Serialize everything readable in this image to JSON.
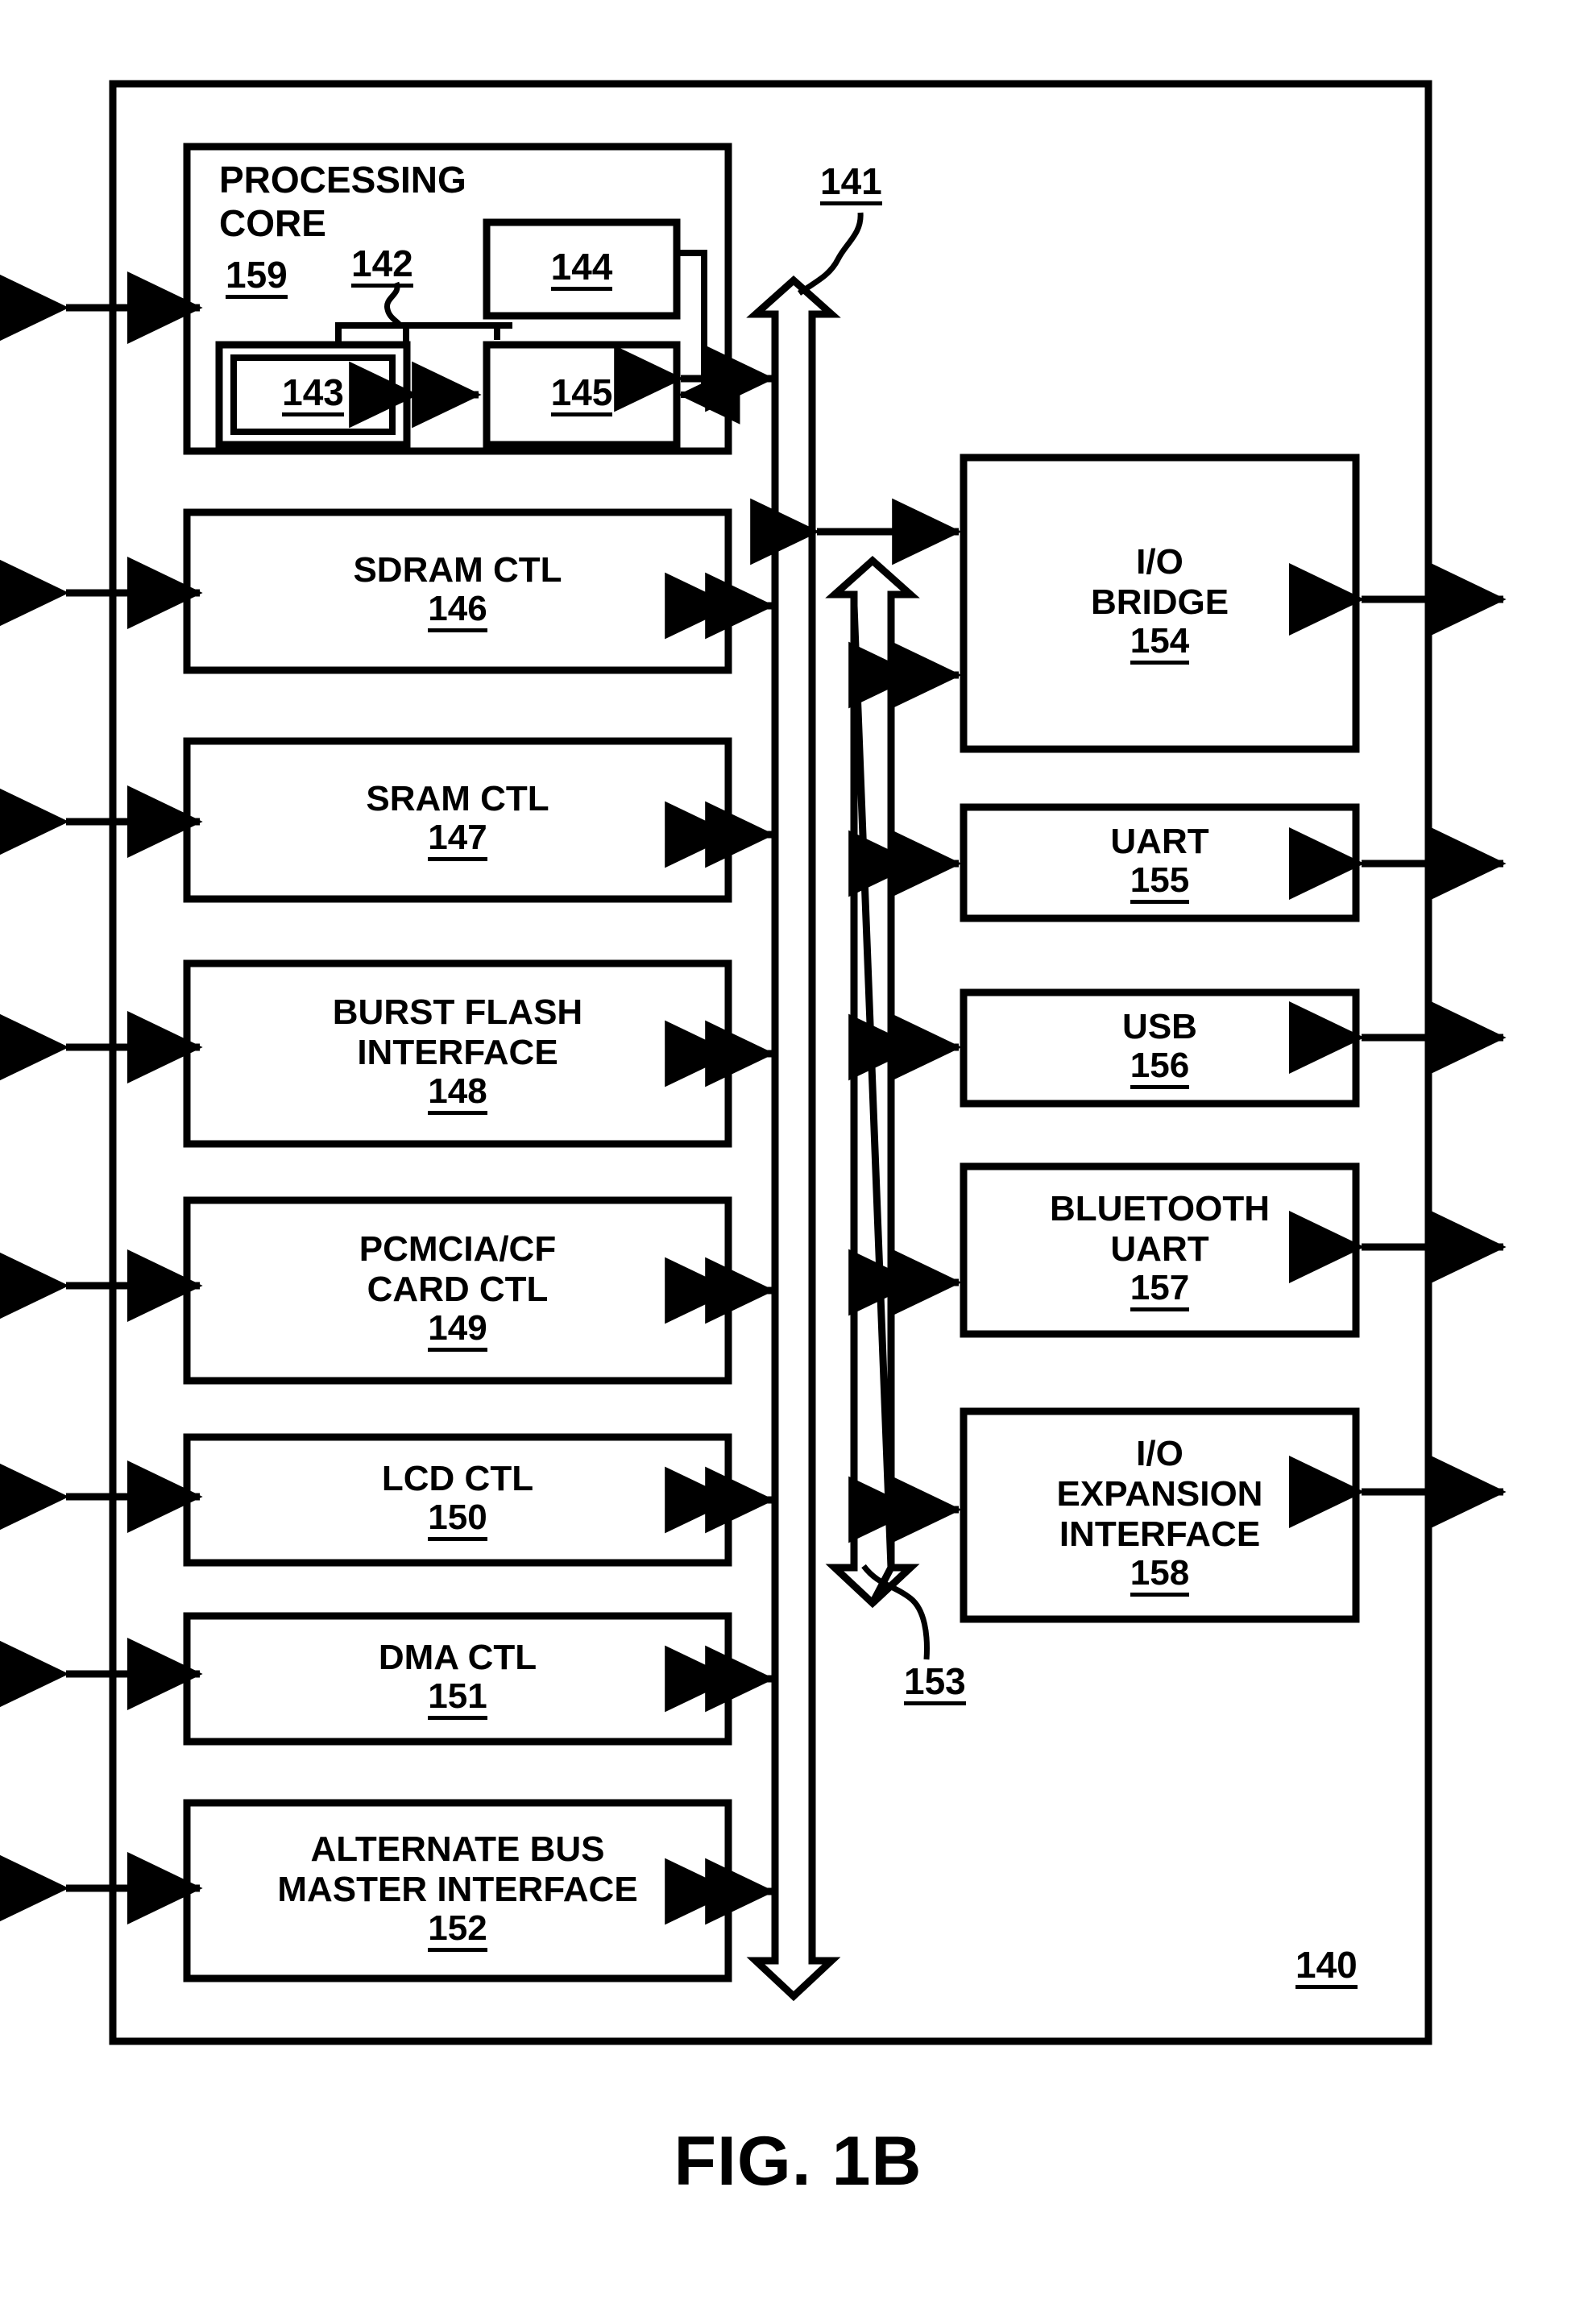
{
  "figure": {
    "caption": "FIG. 1B",
    "system_ref": "140"
  },
  "processing_core": {
    "title_line1": "PROCESSING",
    "title_line2": "CORE",
    "ref": "159",
    "inner_blocks": [
      {
        "name": "cache-block",
        "ref": "142"
      },
      {
        "name": "register-file-block",
        "ref": "143"
      },
      {
        "name": "decode-block",
        "ref": "144"
      },
      {
        "name": "execution-unit-block",
        "ref": "145"
      }
    ]
  },
  "buses": [
    {
      "name": "main-bus",
      "ref": "141"
    },
    {
      "name": "io-bus",
      "ref": "153"
    }
  ],
  "left_column": [
    {
      "name": "sdram-ctl",
      "lines": [
        "SDRAM CTL"
      ],
      "ref": "146"
    },
    {
      "name": "sram-ctl",
      "lines": [
        "SRAM CTL"
      ],
      "ref": "147"
    },
    {
      "name": "burst-flash-interface",
      "lines": [
        "BURST FLASH",
        "INTERFACE"
      ],
      "ref": "148"
    },
    {
      "name": "pcmcia-cf-card-ctl",
      "lines": [
        "PCMCIA/CF",
        "CARD CTL"
      ],
      "ref": "149"
    },
    {
      "name": "lcd-ctl",
      "lines": [
        "LCD CTL"
      ],
      "ref": "150"
    },
    {
      "name": "dma-ctl",
      "lines": [
        "DMA CTL"
      ],
      "ref": "151"
    },
    {
      "name": "alternate-bus-master-interface",
      "lines": [
        "ALTERNATE BUS",
        "MASTER INTERFACE"
      ],
      "ref": "152"
    }
  ],
  "right_column": [
    {
      "name": "io-bridge",
      "lines": [
        "I/O",
        "BRIDGE"
      ],
      "ref": "154"
    },
    {
      "name": "uart",
      "lines": [
        "UART"
      ],
      "ref": "155"
    },
    {
      "name": "usb",
      "lines": [
        "USB"
      ],
      "ref": "156"
    },
    {
      "name": "bluetooth-uart",
      "lines": [
        "BLUETOOTH",
        "UART"
      ],
      "ref": "157"
    },
    {
      "name": "io-expansion-interface",
      "lines": [
        "I/O",
        "EXPANSION",
        "INTERFACE"
      ],
      "ref": "158"
    }
  ],
  "colors": {
    "stroke": "#000000",
    "background": "#ffffff"
  }
}
